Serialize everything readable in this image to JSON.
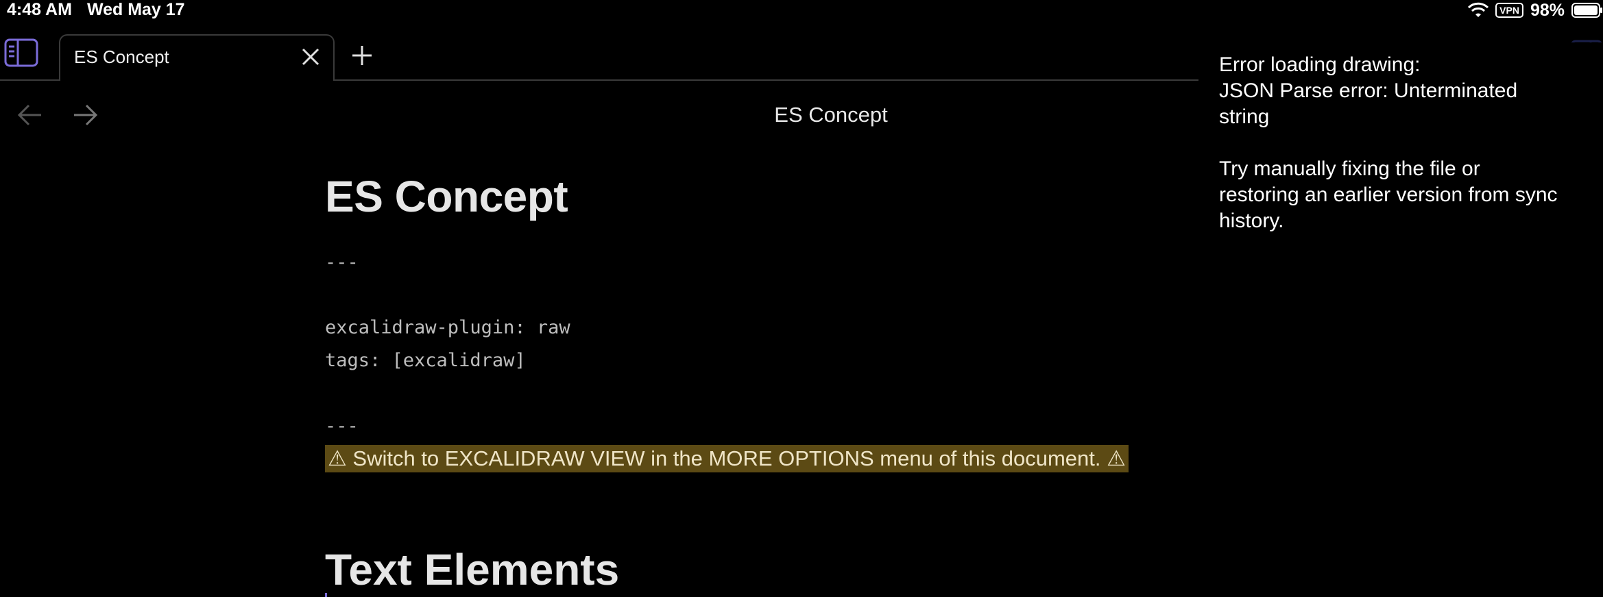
{
  "status_bar": {
    "time": "4:48 AM",
    "date": "Wed May 17",
    "vpn": "VPN",
    "battery": "98%"
  },
  "tabs": [
    {
      "label": "ES Concept",
      "active": true
    }
  ],
  "header": {
    "title": "ES Concept"
  },
  "document": {
    "title": "ES Concept",
    "frontmatter_open": "---",
    "lines": [
      "excalidraw-plugin: raw",
      "tags: [excalidraw]"
    ],
    "frontmatter_close": "---",
    "warning": "⚠  Switch to EXCALIDRAW VIEW in the MORE OPTIONS menu of this document. ⚠",
    "section_heading": "Text Elements"
  },
  "error_notice": {
    "line1": "Error loading drawing:",
    "line2": "JSON Parse error: Unterminated",
    "line3": "string",
    "line4": "Try manually fixing the file or",
    "line5": "restoring an earlier version from sync",
    "line6": "history."
  },
  "colors": {
    "accent": "#7b6cd9",
    "warning_bg": "#5c4a14",
    "background": "#000000"
  }
}
